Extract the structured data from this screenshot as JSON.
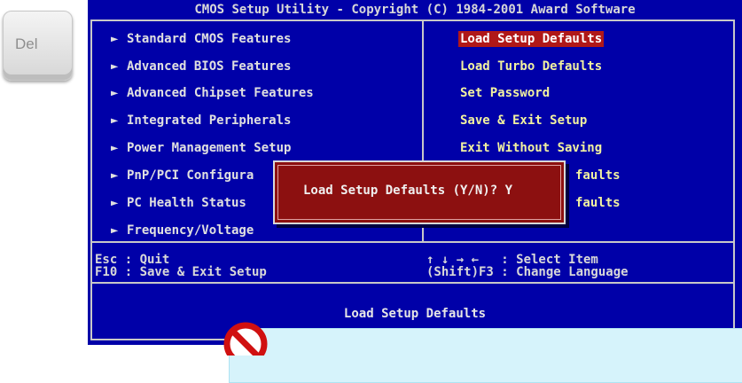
{
  "key_hint": {
    "label": "Del"
  },
  "window": {
    "title": "CMOS Setup Utility - Copyright (C) 1984-2001 Award Software"
  },
  "menu_left": [
    {
      "label": "Standard CMOS Features"
    },
    {
      "label": "Advanced BIOS Features"
    },
    {
      "label": "Advanced Chipset Features"
    },
    {
      "label": "Integrated Peripherals"
    },
    {
      "label": "Power Management Setup"
    },
    {
      "label": "PnP/PCI Configura"
    },
    {
      "label": "PC Health Status"
    },
    {
      "label": "Frequency/Voltage"
    }
  ],
  "menu_right": [
    {
      "label": "Load Setup Defaults",
      "selected": true
    },
    {
      "label": "Load Turbo Defaults"
    },
    {
      "label": "Set Password"
    },
    {
      "label": "Save & Exit Setup"
    },
    {
      "label": "Exit Without Saving"
    },
    {
      "label": "faults"
    },
    {
      "label": "faults"
    }
  ],
  "submenu_arrow": "►",
  "help": {
    "left_line1": "Esc : Quit",
    "left_line2": "F10 : Save & Exit Setup",
    "right_line1": "↑ ↓ → ←   : Select Item",
    "right_line2": "(Shift)F3 : Change Language"
  },
  "status": {
    "text": "Load Setup Defaults"
  },
  "dialog": {
    "text": "Load Setup Defaults (Y/N)? Y"
  },
  "colors": {
    "screen_bg": "#0000a8",
    "highlight": "#b01818",
    "dialog_bg": "#8c1010",
    "right_text": "#f2f2a0"
  },
  "icons": {
    "no_sign": "prohibited-icon"
  }
}
